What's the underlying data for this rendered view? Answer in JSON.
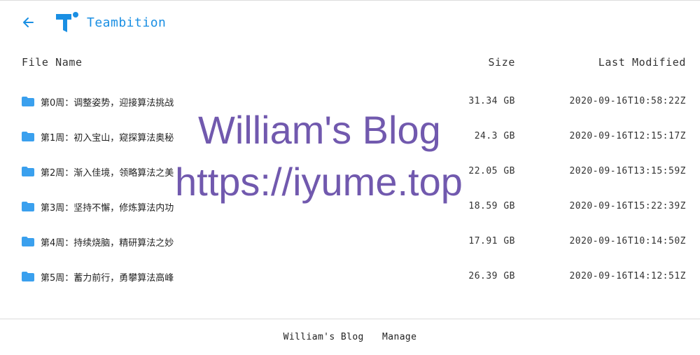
{
  "header": {
    "brand": "Teambition"
  },
  "columns": {
    "name": "File Name",
    "size": "Size",
    "modified": "Last Modified"
  },
  "files": [
    {
      "name": "第0周：调整姿势，迎接算法挑战",
      "size": "31.34 GB",
      "modified": "2020-09-16T10:58:22Z"
    },
    {
      "name": "第1周：初入宝山，窥探算法奥秘",
      "size": "24.3 GB",
      "modified": "2020-09-16T12:15:17Z"
    },
    {
      "name": "第2周：渐入佳境，领略算法之美",
      "size": "22.05 GB",
      "modified": "2020-09-16T13:15:59Z"
    },
    {
      "name": "第3周：坚持不懈，修炼算法内功",
      "size": "18.59 GB",
      "modified": "2020-09-16T15:22:39Z"
    },
    {
      "name": "第4周：持续烧脑，精研算法之妙",
      "size": "17.91 GB",
      "modified": "2020-09-16T10:14:50Z"
    },
    {
      "name": "第5周：蓄力前行，勇攀算法高峰",
      "size": "26.39 GB",
      "modified": "2020-09-16T14:12:51Z"
    }
  ],
  "watermark": {
    "line1": "William's Blog",
    "line2": "https://iyume.top"
  },
  "footer": {
    "blog": "William's Blog",
    "manage": "Manage"
  },
  "colors": {
    "accent": "#1a8fe3",
    "folder": "#3aa0ee",
    "watermark": "#583ca0"
  }
}
